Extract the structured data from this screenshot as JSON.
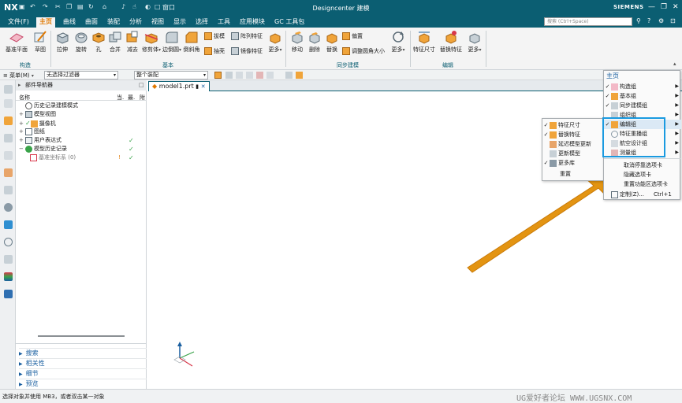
{
  "titlebar": {
    "app_logo": "NX",
    "title": "Designcenter 建模",
    "brand": "SIEMENS",
    "window_menu": "窗口"
  },
  "menubar": {
    "items": [
      "文件(F)",
      "主页",
      "曲线",
      "曲面",
      "装配",
      "分析",
      "视图",
      "显示",
      "选择",
      "工具",
      "应用模块",
      "GC 工具包"
    ],
    "search_placeholder": "搜索 (Ctrl+Space)"
  },
  "ribbon": {
    "buttons": {
      "datum_plane": "基准平面",
      "sketch": "草图",
      "extrude": "拉伸",
      "revolve": "旋转",
      "hole": "孔",
      "unite": "合并",
      "subtract": "减去",
      "trim_body": "修剪体",
      "edge_blend": "边倒圆",
      "chamfer": "倒斜角",
      "draft": "拔模",
      "pattern_feature": "阵列特征",
      "shell": "抽壳",
      "mirror_feature": "镜像特征",
      "more1": "更多",
      "move": "移动",
      "delete": "删除",
      "replace": "替换",
      "offset": "偏置",
      "resize_blend": "调整圆角大小",
      "more2": "更多",
      "feature_dimensions": "特征尺寸",
      "replace_feature": "替换特征",
      "more3": "更多"
    },
    "groups": {
      "construct": "构造",
      "base": "基本",
      "sync": "同步建模",
      "edit": "编辑"
    }
  },
  "selbar": {
    "menu": "菜单(M)",
    "filter": "无选择过滤器",
    "scope": "整个装配"
  },
  "navigator": {
    "title": "部件导航器",
    "col_name": "名称",
    "col_2": "当.",
    "col_3": "最.",
    "col_4": "附",
    "rows": [
      {
        "label": "历史记录建模模式",
        "tog": ""
      },
      {
        "label": "模型视图",
        "tog": "+"
      },
      {
        "label": "摄像机",
        "tog": "+"
      },
      {
        "label": "图纸",
        "tog": "+"
      },
      {
        "label": "用户表达式",
        "tog": "+"
      },
      {
        "label": "模型历史记录",
        "tog": "−"
      },
      {
        "label": "基准坐标系 (0)",
        "tog": ""
      }
    ],
    "panels": [
      "搜索",
      "相关性",
      "细节",
      "预览"
    ]
  },
  "graphics": {
    "tab": "model1.prt"
  },
  "home_menu": {
    "title": "主页",
    "items": [
      {
        "label": "构造组",
        "checked": true
      },
      {
        "label": "基本组",
        "checked": true
      },
      {
        "label": "同步建模组",
        "checked": true
      },
      {
        "label": "组织组",
        "checked": false
      },
      {
        "label": "编辑组",
        "checked": true
      },
      {
        "label": "特征重播组",
        "checked": false
      },
      {
        "label": "航空设计组",
        "checked": false
      },
      {
        "label": "测量组",
        "checked": false
      }
    ],
    "extra": [
      "取消停靠选项卡",
      "隐藏选项卡",
      "重置功能区选项卡"
    ],
    "customize": "定制(Z)...",
    "customize_shortcut": "Ctrl+1"
  },
  "edit_submenu": {
    "items": [
      {
        "label": "特征尺寸",
        "checked": true
      },
      {
        "label": "替换特征",
        "checked": true
      },
      {
        "label": "延迟模型更新",
        "checked": false
      },
      {
        "label": "更新模型",
        "checked": false
      },
      {
        "label": "更多库",
        "checked": true
      }
    ],
    "reset": "重置"
  },
  "status": {
    "text": "选择对象并使用 MB3，或者双击某一对象",
    "watermark": "UG爱好者论坛 WWW.UGSNX.COM"
  },
  "colors": {
    "title_bar": "#0b5e72",
    "accent_orange": "#e07800",
    "highlight_blue": "#1a9ae0",
    "arrow": "#e39412"
  }
}
